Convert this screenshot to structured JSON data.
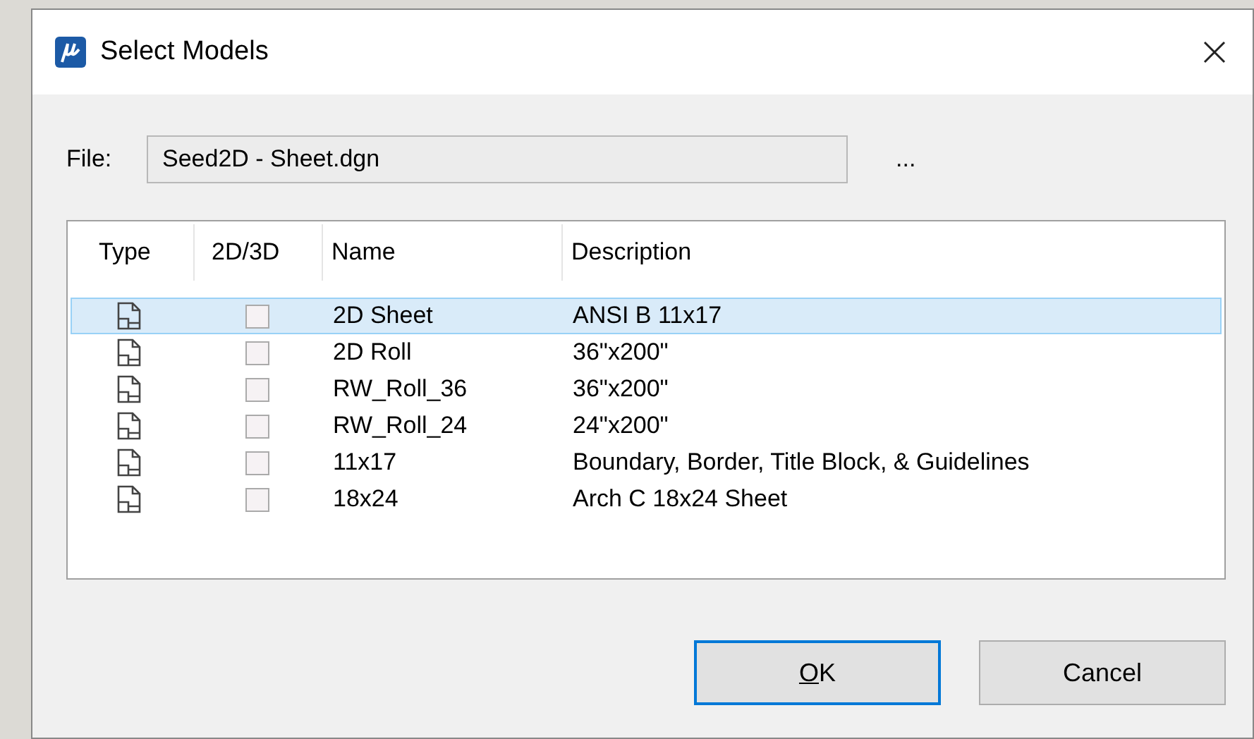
{
  "window": {
    "title": "Select Models"
  },
  "file": {
    "label": "File:",
    "value": "Seed2D - Sheet.dgn",
    "browse": "..."
  },
  "table": {
    "columns": [
      "Type",
      "2D/3D",
      "Name",
      "Description"
    ],
    "rows": [
      {
        "name": "2D Sheet",
        "description": "ANSI B 11x17",
        "checked": false,
        "selected": true
      },
      {
        "name": "2D Roll",
        "description": "36\"x200\"",
        "checked": false,
        "selected": false
      },
      {
        "name": "RW_Roll_36",
        "description": "36\"x200\"",
        "checked": false,
        "selected": false
      },
      {
        "name": "RW_Roll_24",
        "description": "24\"x200\"",
        "checked": false,
        "selected": false
      },
      {
        "name": "11x17",
        "description": "Boundary, Border, Title Block, & Guidelines",
        "checked": false,
        "selected": false
      },
      {
        "name": "18x24",
        "description": "Arch C 18x24 Sheet",
        "checked": false,
        "selected": false
      }
    ]
  },
  "buttons": [
    {
      "label": "OK",
      "default": true,
      "access_key_underlined": true
    },
    {
      "label": "Cancel",
      "default": false
    }
  ]
}
